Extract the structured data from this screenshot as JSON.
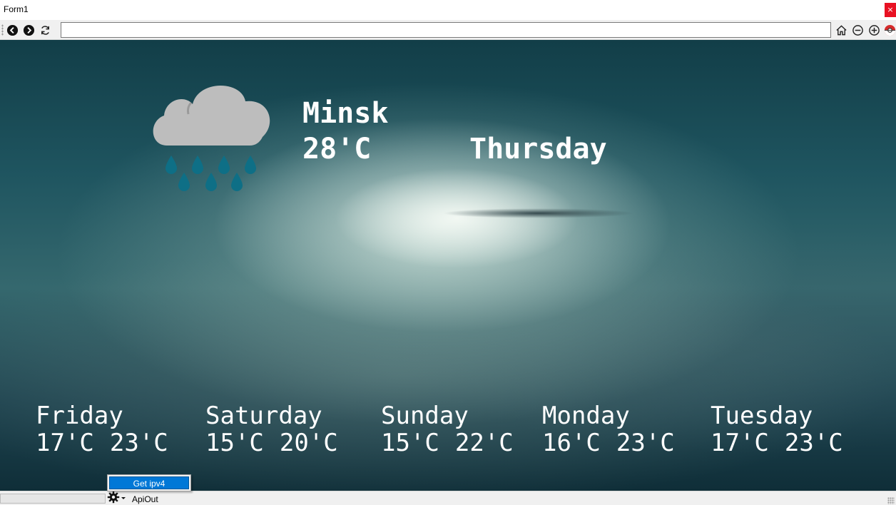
{
  "window": {
    "title": "Form1",
    "close_label": "×"
  },
  "toolbar": {
    "url_value": "",
    "icons": [
      "back-icon",
      "forward-icon",
      "refresh-icon",
      "home-icon",
      "zoom-out-icon",
      "zoom-in-icon",
      "browser-logo-icon"
    ]
  },
  "weather": {
    "icon": "rain-cloud-icon",
    "city": "Minsk",
    "current_temp": "28'C",
    "current_day": "Thursday",
    "forecast": [
      {
        "day": "Friday",
        "min": "17'C",
        "max": "23'C"
      },
      {
        "day": "Saturday",
        "min": "15'C",
        "max": "20'C"
      },
      {
        "day": "Sunday",
        "min": "15'C",
        "max": "22'C"
      },
      {
        "day": "Monday",
        "min": "16'C",
        "max": "23'C"
      },
      {
        "day": "Tuesday",
        "min": "17'C",
        "max": "23'C"
      }
    ]
  },
  "statusbar": {
    "progress": 0,
    "dropdown_icon": "gear-icon",
    "label": "ApiOut"
  },
  "menu": {
    "items": [
      {
        "label": "Get ipv4"
      }
    ]
  },
  "colors": {
    "cloud_gray": "#bdbdbd",
    "rain_drop": "#0e6f86",
    "menu_highlight": "#0078d7",
    "close_red": "#e81123"
  }
}
